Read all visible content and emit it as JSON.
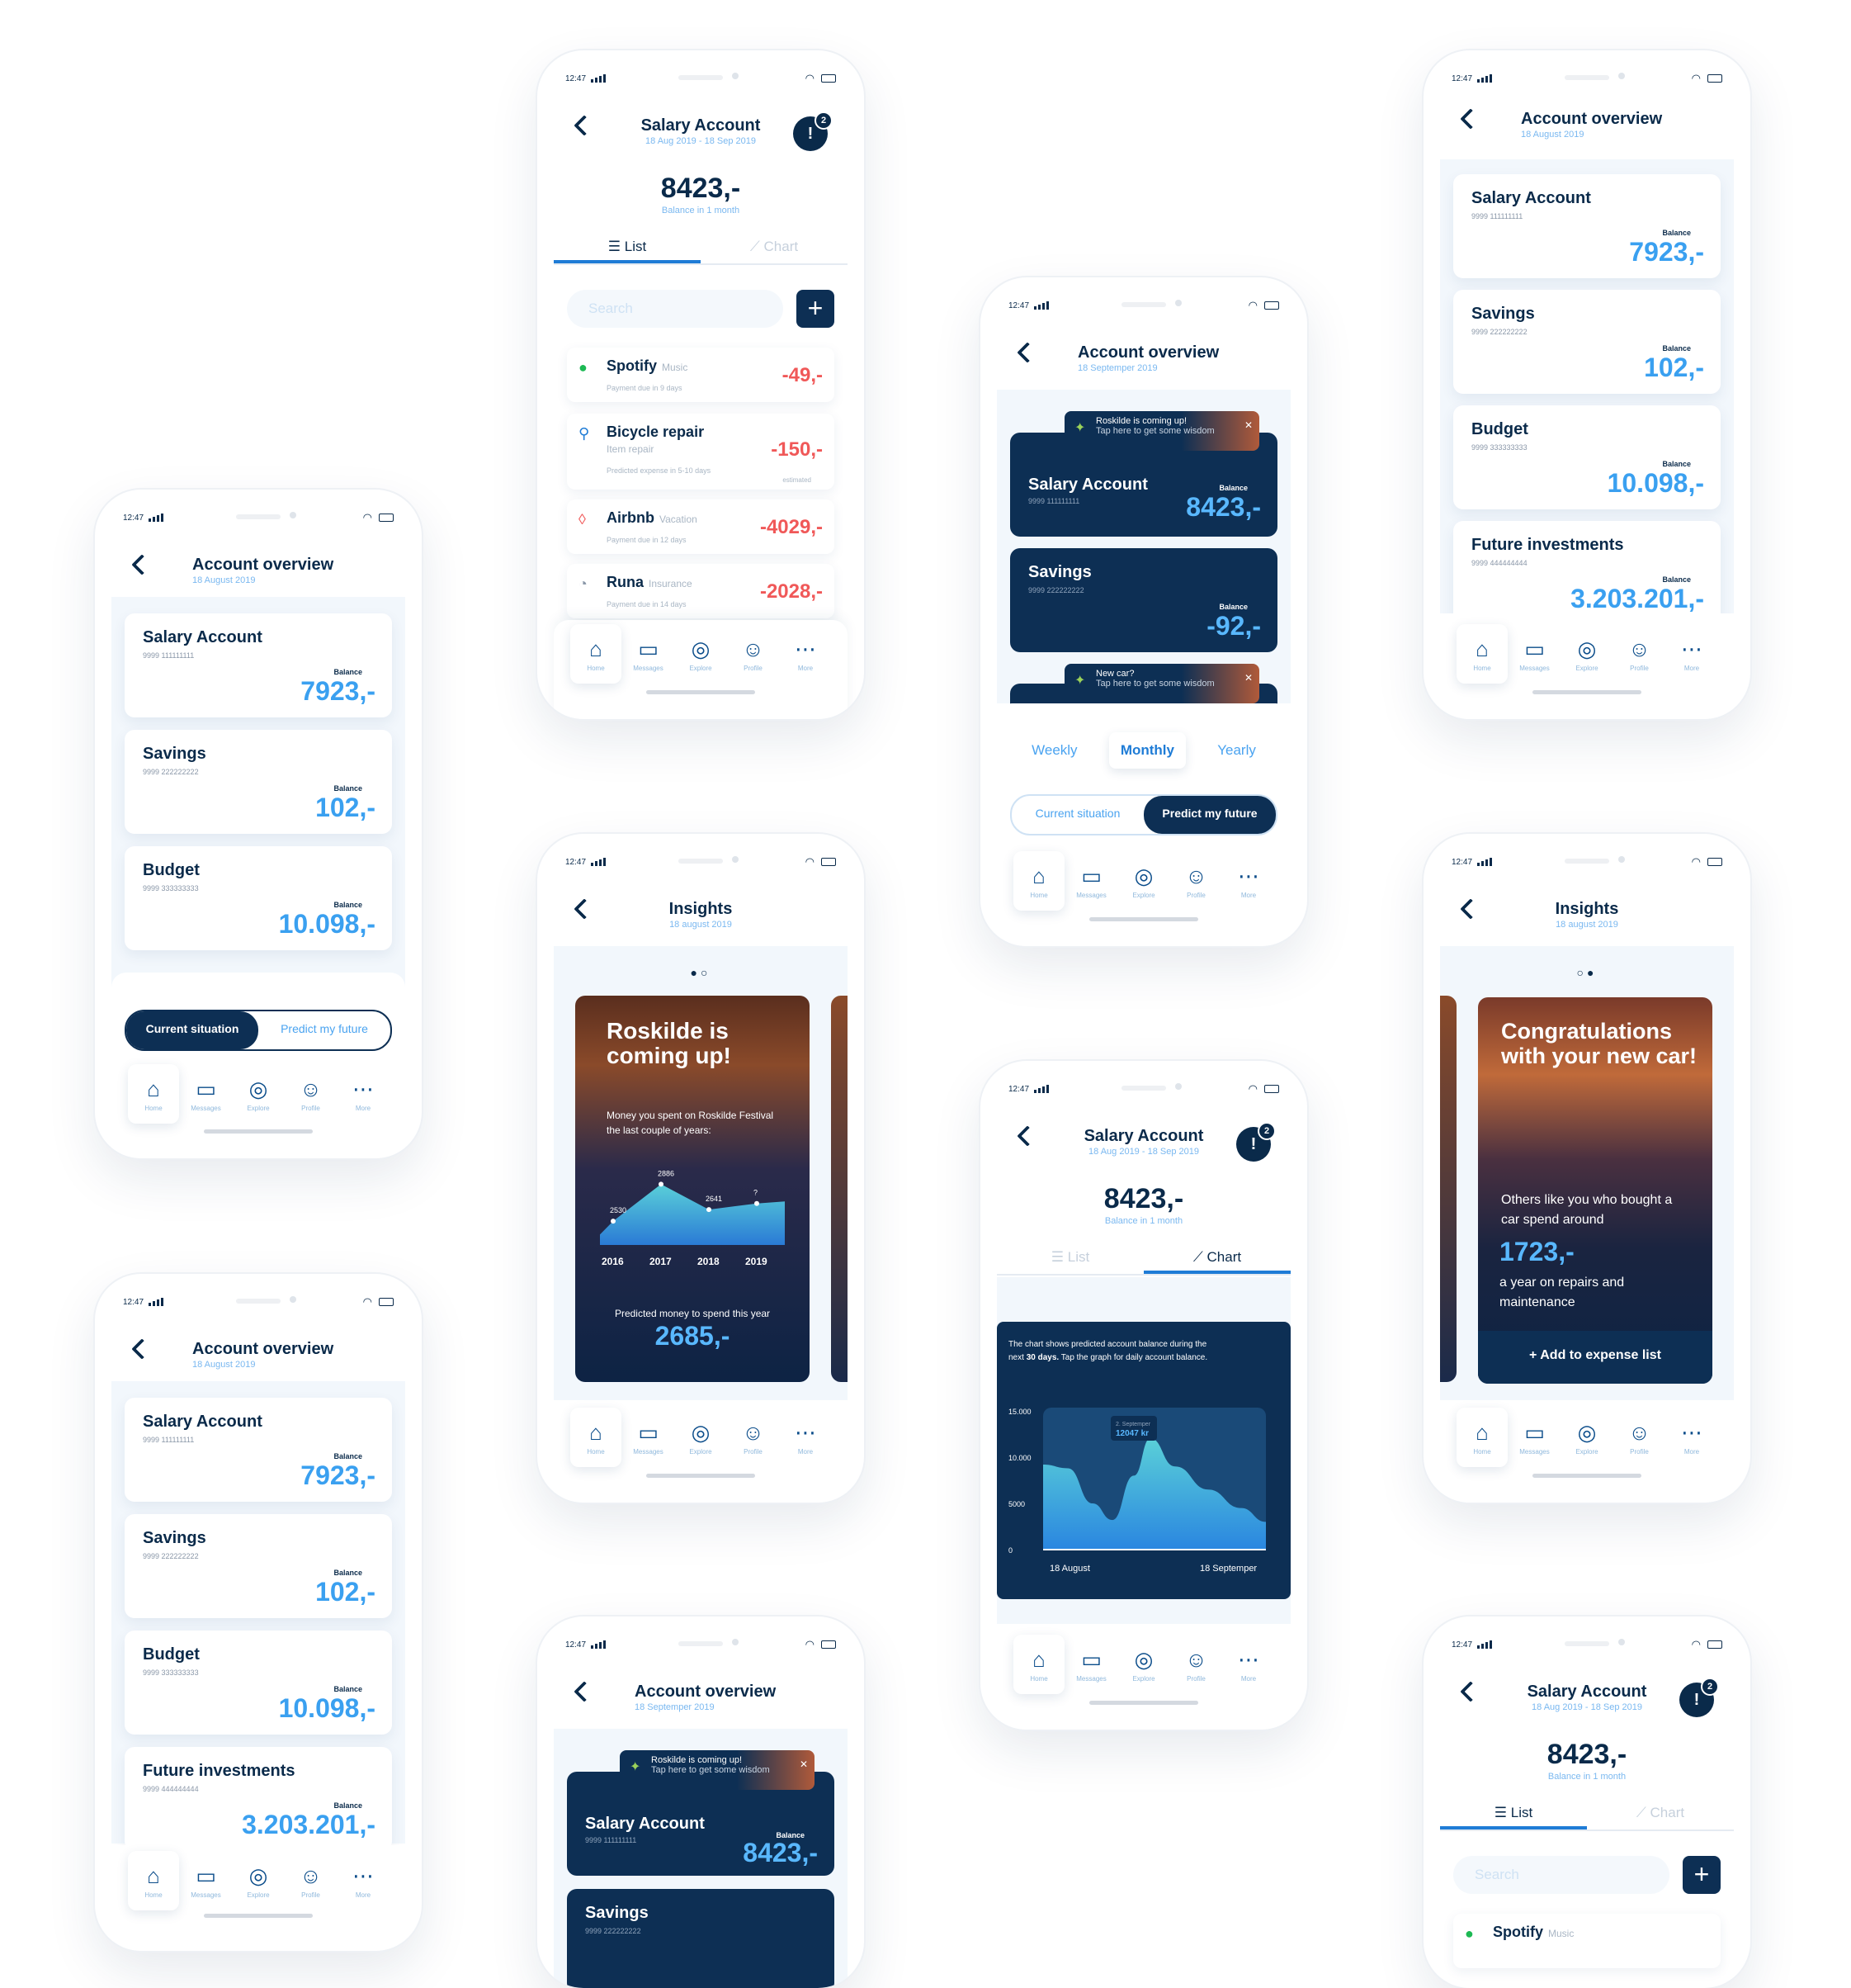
{
  "status": {
    "time": "12:47"
  },
  "nav": {
    "home": "Home",
    "messages": "Messages",
    "explore": "Explore",
    "profile": "Profile",
    "more": "More"
  },
  "overview": {
    "title": "Account overview",
    "date_aug": "18 August 2019",
    "date_sep": "18 Septemper 2019",
    "balance_label": "Balance",
    "accounts": [
      {
        "name": "Salary Account",
        "number": "9999 111111111",
        "balance": "7923,-"
      },
      {
        "name": "Savings",
        "number": "9999 222222222",
        "balance": "102,-"
      },
      {
        "name": "Budget",
        "number": "9999 333333333",
        "balance": "10.098,-"
      },
      {
        "name": "Future investments",
        "number": "9999 444444444",
        "balance": "3.203.201,-"
      }
    ],
    "dark_accounts": [
      {
        "name": "Salary Account",
        "number": "9999 111111111",
        "balance": "8423,-"
      },
      {
        "name": "Savings",
        "number": "9999 222222222",
        "balance": "-92,-"
      }
    ],
    "toast1_title": "Roskilde is coming up!",
    "toast1_sub": "Tap here to get some wisdom",
    "toast2_title": "New car?",
    "toast2_sub": "Tap here to get some wisdom",
    "current": "Current situation",
    "predict": "Predict my future",
    "weekly": "Weekly",
    "monthly": "Monthly",
    "yearly": "Yearly"
  },
  "salary": {
    "title": "Salary Account",
    "range": "18 Aug 2019 - 18 Sep 2019",
    "badge": "2",
    "balance": "8423,-",
    "balance_sub": "Balance in 1 month",
    "tab_list": "List",
    "tab_chart": "Chart",
    "search_placeholder": "Search",
    "transactions": [
      {
        "name": "Spotify",
        "cat": "Music",
        "note": "Payment due in 9 days",
        "amount": "-49,-"
      },
      {
        "name": "Bicycle repair",
        "sub": "Item repair",
        "note": "Predicted expense in 5-10 days",
        "est": "estimated",
        "amount": "-150,-"
      },
      {
        "name": "Airbnb",
        "cat": "Vacation",
        "note": "Payment due in 12 days",
        "amount": "-4029,-"
      },
      {
        "name": "Runa",
        "cat": "Insurance",
        "note": "Payment due in 14 days",
        "amount": "-2028,-"
      }
    ],
    "chart_desc_1": "The chart shows predicted account balance during the",
    "chart_desc_2a": "next ",
    "chart_desc_2b": "30 days.",
    "chart_desc_2c": " Tap the graph for daily account balance.",
    "chart_tip_date": "2. Septemper",
    "chart_tip_val": "12047 kr",
    "chart_x_start": "18 August",
    "chart_x_end": "18 Septemper",
    "chart_y": [
      "15.000",
      "10.000",
      "5000",
      "0"
    ]
  },
  "insights": {
    "title": "Insights",
    "date": "18 august 2019",
    "roskilde_title": "Roskilde is coming up!",
    "roskilde_text": "Money you spent on Roskilde Festival the last couple of years:",
    "predicted_label": "Predicted money to spend this year",
    "predicted_value": "2685,-",
    "car_title": "Congratulations with your new car!",
    "car_text": "Others like you who bought a car spend around",
    "car_value": "1723,-",
    "car_text2": "a year on repairs and maintenance",
    "add_button": "Add to expense list"
  },
  "chart_data": [
    {
      "type": "area",
      "x": [
        "2016",
        "2017",
        "2018",
        "2019"
      ],
      "values": [
        2530,
        2886,
        2641,
        null
      ],
      "labels": [
        "2530",
        "2886",
        "2641",
        "?"
      ],
      "title": "",
      "xlabel": "",
      "ylabel": ""
    },
    {
      "type": "area",
      "x": [
        "18 August",
        "18 Septemper"
      ],
      "ylim": [
        0,
        15000
      ],
      "yticks": [
        "15.000",
        "10.000",
        "5000",
        "0"
      ],
      "highlight": {
        "label": "2. Septemper",
        "value": 12047
      },
      "title": "",
      "xlabel": "",
      "ylabel": ""
    }
  ]
}
